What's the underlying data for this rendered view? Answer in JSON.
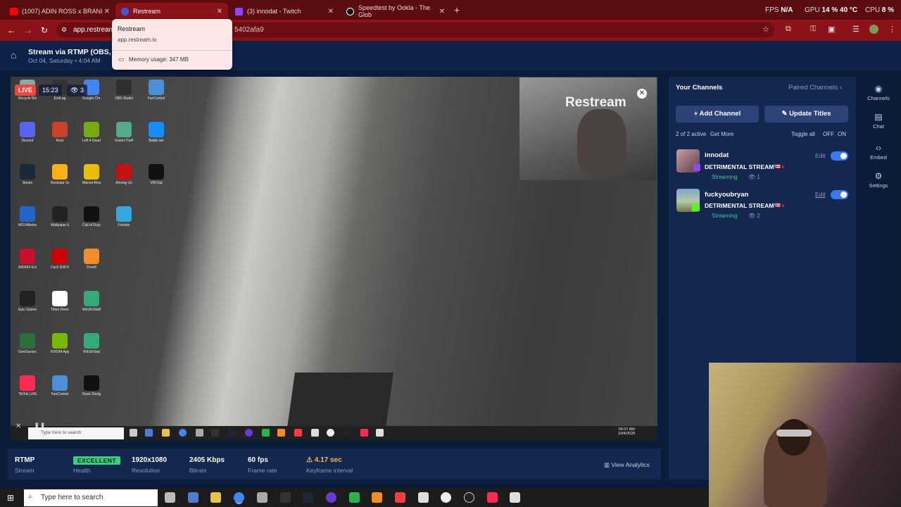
{
  "browser": {
    "tabs": [
      {
        "title": "(1007) ADIN ROSS x BRANI",
        "color": "#ff0000"
      },
      {
        "title": "Restream",
        "color": "#3a5bd9"
      },
      {
        "title": "(3) innodat - Twitch",
        "color": "#9146ff"
      },
      {
        "title": "Speedtest by Ookla - The Glob",
        "color": "#1a1a1a"
      }
    ],
    "new_tab": "+",
    "url": "app.restream",
    "url_tail": "5402afa9",
    "hud": {
      "fps_label": "FPS",
      "fps_value": "N/A",
      "gpu_label": "GPU",
      "gpu_value": "14 % 40 °C",
      "cpu_label": "CPU",
      "cpu_value": "8 %"
    }
  },
  "tooltip": {
    "title": "Restream",
    "domain": "app.restream.io",
    "memory": "Memory usage: 347 MB"
  },
  "header": {
    "title": "Stream via RTMP (OBS, Vm",
    "date": "Oct 04, Saturday • 4:04 AM"
  },
  "preview": {
    "live": "LIVE",
    "timer": "15:23",
    "viewers": "3",
    "watermark": "Restream",
    "desktop_icons": [
      {
        "label": "Recycle Bin",
        "color": "#8aa"
      },
      {
        "label": "Discord",
        "color": "#5865f2"
      },
      {
        "label": "Steam",
        "color": "#1b2838"
      },
      {
        "label": "MSI Afterburner",
        "color": "#2266cc"
      },
      {
        "label": "AIDA64 Extreme",
        "color": "#c8102e"
      },
      {
        "label": "Epic Games Launcher",
        "color": "#222"
      },
      {
        "label": "GeoGuessr Steam Edition",
        "color": "#2b6e3c"
      },
      {
        "label": "TikTok LIVE Studio",
        "color": "#fe2c55"
      },
      {
        "label": "ExitLag",
        "color": "#333"
      },
      {
        "label": "Rust",
        "color": "#cd412b"
      },
      {
        "label": "Rockstar Games Launcher",
        "color": "#fcaf17"
      },
      {
        "label": "Wallpaper Engine",
        "color": "#222"
      },
      {
        "label": "CarX Drift Racing Online",
        "color": "#c00"
      },
      {
        "label": "Timer Resolution",
        "color": "#fff"
      },
      {
        "label": "NVIDIA App",
        "color": "#76b900"
      },
      {
        "label": "FanControl",
        "color": "#4a90d9"
      },
      {
        "label": "Google Chrome",
        "color": "#4285f4"
      },
      {
        "label": "Left 4 Dead 2",
        "color": "#7a1"
      },
      {
        "label": "Marvel Rivals",
        "color": "#e8c000"
      },
      {
        "label": "Call of Duty Black Ops Co...",
        "color": "#111"
      },
      {
        "label": "FiveM",
        "color": "#f28c28"
      },
      {
        "label": "WinDirStat64",
        "color": "#3a7"
      },
      {
        "label": "WinDirStat",
        "color": "#3a7"
      },
      {
        "label": "Rush Shotgun",
        "color": "#111"
      },
      {
        "label": "OBS Studio",
        "color": "#302e31"
      },
      {
        "label": "Grand Theft Auto V",
        "color": "#5a8"
      },
      {
        "label": "Among Us",
        "color": "#c51111"
      },
      {
        "label": "Fortnite",
        "color": "#35a7e0"
      },
      {
        "label": "FanControl",
        "color": "#4a90d9"
      },
      {
        "label": "Battle.net",
        "color": "#148eff"
      },
      {
        "label": "VRChat",
        "color": "#111"
      }
    ],
    "taskbar_search": "Type here to search",
    "taskbar_time": "04:07 AM",
    "taskbar_date": "10/4/2025"
  },
  "stats": [
    {
      "value": "RTMP",
      "label": "Stream"
    },
    {
      "value": "EXCELLENT",
      "label": "Health"
    },
    {
      "value": "1920x1080",
      "label": "Resolution"
    },
    {
      "value": "2405 Kbps",
      "label": "Bitrate"
    },
    {
      "value": "60 fps",
      "label": "Frame rate"
    },
    {
      "value": "4.17 sec",
      "label": "Keyframe interval"
    }
  ],
  "view_analytics": "View Analytics",
  "channels": {
    "title": "Your Channels",
    "paired": "Paired Channels",
    "add": "Add Channel",
    "update": "Update Titles",
    "active": "2 of 2 active",
    "get_more": "Get More",
    "toggle_all": "Toggle all",
    "off": "OFF",
    "on": "ON",
    "items": [
      {
        "name": "innodat",
        "title": "DETRIMENTAL STREAM",
        "status": "Streaming",
        "viewers": "1",
        "edit": "Edit",
        "platform_color": "#9146ff"
      },
      {
        "name": "fuckyoubryan",
        "title": "DETRIMENTAL STREAM",
        "status": "Streaming",
        "viewers": "2",
        "edit": "Edit",
        "platform_color": "#53fc18"
      }
    ]
  },
  "sidebar": [
    {
      "label": "Channels",
      "icon": "broadcast-icon"
    },
    {
      "label": "Chat",
      "icon": "chat-icon"
    },
    {
      "label": "Embed",
      "icon": "code-icon"
    },
    {
      "label": "Settings",
      "icon": "gear-icon"
    }
  ],
  "windows_taskbar": {
    "search": "Type here to search"
  }
}
